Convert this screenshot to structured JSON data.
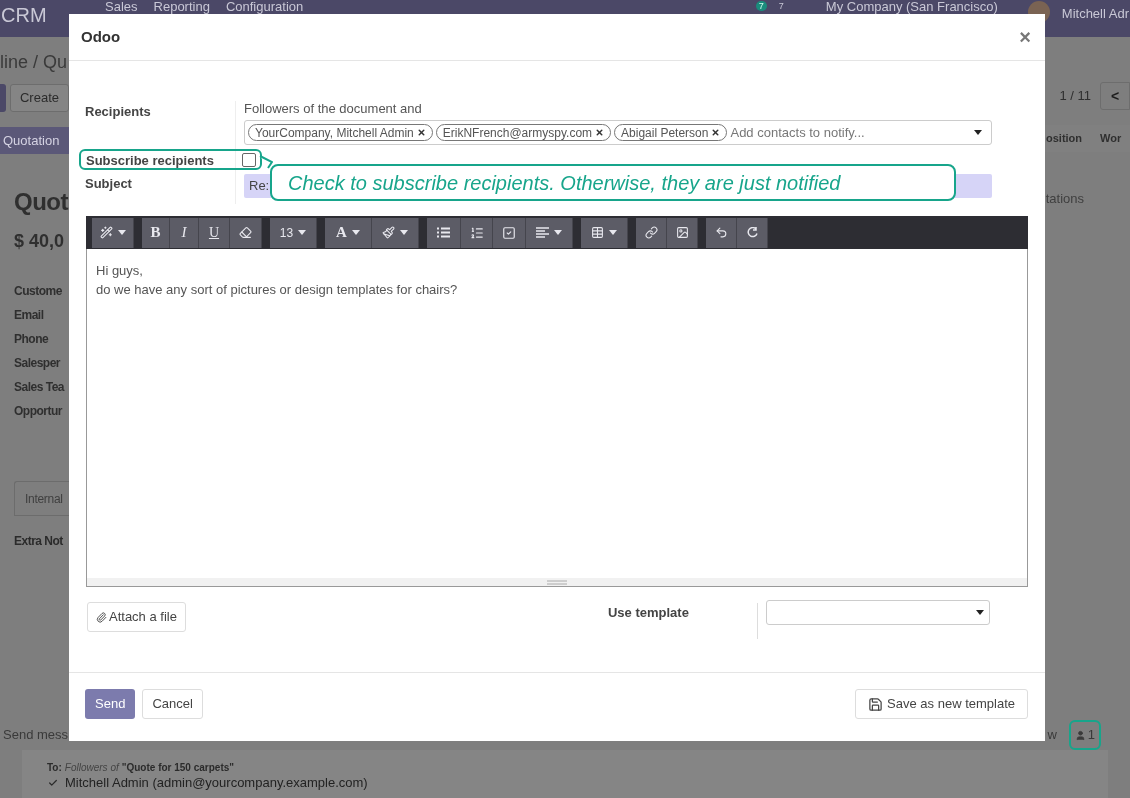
{
  "background": {
    "app_bar": {
      "app": "CRM",
      "menus": [
        "Sales",
        "Reporting",
        "Configuration"
      ],
      "activity_count": "7",
      "message_count": "7",
      "company": "My Company (San Francisco)",
      "user": "Mitchell Adr"
    },
    "breadcrumb": "line / Qu",
    "create_button": "Create",
    "pager": "1 / 11",
    "pager_prev": "<",
    "stage": "Quotation",
    "status_steps": [
      "osition",
      "Wor"
    ],
    "left_fields": [
      {
        "kind": "title",
        "text": "Quot"
      },
      {
        "kind": "amount",
        "text": "$ 40,0"
      },
      {
        "kind": "label",
        "text": "Custome"
      },
      {
        "kind": "label",
        "text": "Email"
      },
      {
        "kind": "label",
        "text": "Phone"
      },
      {
        "kind": "label",
        "text": "Salesper"
      },
      {
        "kind": "label",
        "text": "Sales Tea"
      },
      {
        "kind": "label",
        "text": "Opportur"
      }
    ],
    "notebook_tab": "Internal",
    "right_tab": "tations",
    "extra_notes": "Extra Not",
    "chatter": {
      "send_message": "Send mess",
      "follow": "w",
      "followers_count": "1",
      "followers_highlighted": true,
      "to_prefix": "To:",
      "to_followers": "Followers of",
      "to_record": "\"Quote for 150 carpets\"",
      "recipients": [
        {
          "label": "Mitchell Admin (admin@yourcompany.example.com)",
          "checked": true
        }
      ]
    }
  },
  "dialog": {
    "title": "Odoo",
    "close": "×",
    "recipients": {
      "label": "Recipients",
      "intro": "Followers of the document and",
      "tags": [
        "YourCompany, Mitchell Admin",
        "ErikNFrench@armyspy.com",
        "Abigail Peterson"
      ],
      "placeholder": "Add contacts to notify..."
    },
    "subscribe": {
      "label": "Subscribe recipients",
      "checked": false,
      "highlighted": true
    },
    "subject": {
      "label": "Subject",
      "value": "Re:"
    },
    "tooltip": "Check to subscribe recipients. Otherwise, they are just notified",
    "toolbar": {
      "font_size": "13",
      "bold": "B",
      "italic": "I",
      "underline": "U",
      "font_color": "A"
    },
    "body_lines": [
      "Hi guys,",
      "do we have any sort of pictures or design templates for chairs?"
    ],
    "attach": "Attach a file",
    "use_template": {
      "label": "Use template"
    },
    "buttons": {
      "send": "Send",
      "cancel": "Cancel",
      "save_template": "Save as new template"
    }
  }
}
